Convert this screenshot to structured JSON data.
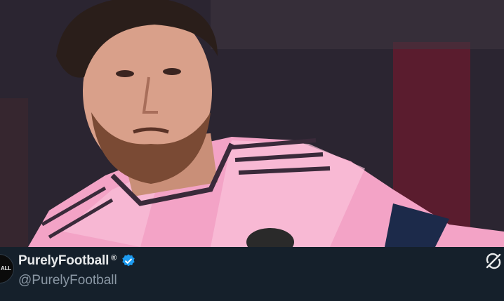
{
  "post_media": {
    "alt": ""
  },
  "author": {
    "avatar_text": "ALL",
    "display_name": "PurelyFootball",
    "registered_mark": "®",
    "handle": "@PurelyFootball",
    "verified_icon": "verified-badge-icon",
    "verified_color": "#1d9bf0"
  },
  "actions": {
    "right_icon": "repost-sync-icon"
  },
  "colors": {
    "background": "#15202b",
    "name_text": "#e7e9ea",
    "handle_text": "#8b98a5",
    "jersey_pink": "#f7a8c8"
  }
}
